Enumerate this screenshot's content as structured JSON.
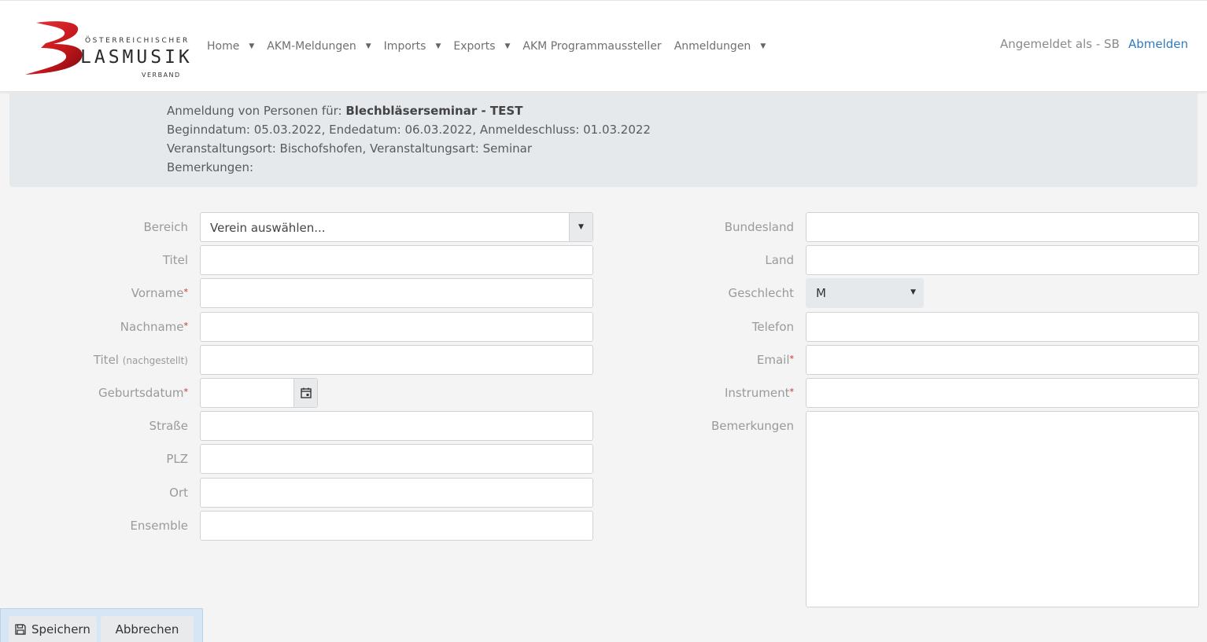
{
  "header": {
    "logo": {
      "top_text": "ÖSTERREICHISCHER",
      "main_text": "LASMUSIK",
      "bottom_text": "VERBAND",
      "brand_color": "#c4161c"
    },
    "nav": [
      {
        "label": "Home",
        "has_dropdown": true
      },
      {
        "label": "AKM-Meldungen",
        "has_dropdown": true
      },
      {
        "label": "Imports",
        "has_dropdown": true
      },
      {
        "label": "Exports",
        "has_dropdown": true
      },
      {
        "label": "AKM Programmaussteller",
        "has_dropdown": false
      },
      {
        "label": "Anmeldungen",
        "has_dropdown": true
      }
    ],
    "logged_in_text": "Angemeldet als - SB",
    "logout_label": "Abmelden"
  },
  "info": {
    "line1_prefix": "Anmeldung von Personen für: ",
    "line1_event": "Blechbläserseminar - TEST",
    "line2": "Beginndatum: 05.03.2022, Endedatum: 06.03.2022, Anmeldeschluss: 01.03.2022",
    "line3": "Veranstaltungsort: Bischofshofen, Veranstaltungsart: Seminar",
    "line4": "Bemerkungen:"
  },
  "form": {
    "bereich": {
      "label": "Bereich",
      "value": "Verein auswählen..."
    },
    "titel": {
      "label": "Titel",
      "value": ""
    },
    "vorname": {
      "label": "Vorname",
      "required": "*",
      "value": ""
    },
    "nachname": {
      "label": "Nachname",
      "required": "*",
      "value": ""
    },
    "titel_nach": {
      "label": "Titel",
      "label_small": "(nachgestellt)",
      "value": ""
    },
    "geburtsdatum": {
      "label": "Geburtsdatum",
      "required": "*",
      "value": ""
    },
    "strasse": {
      "label": "Straße",
      "value": ""
    },
    "plz": {
      "label": "PLZ",
      "value": ""
    },
    "ort": {
      "label": "Ort",
      "value": ""
    },
    "ensemble": {
      "label": "Ensemble",
      "value": ""
    },
    "bundesland": {
      "label": "Bundesland",
      "value": ""
    },
    "land": {
      "label": "Land",
      "value": ""
    },
    "geschlecht": {
      "label": "Geschlecht",
      "value": "M"
    },
    "telefon": {
      "label": "Telefon",
      "value": ""
    },
    "email": {
      "label": "Email",
      "required": "*",
      "value": ""
    },
    "instrument": {
      "label": "Instrument",
      "required": "*",
      "value": ""
    },
    "bemerkungen": {
      "label": "Bemerkungen",
      "value": ""
    }
  },
  "actions": {
    "save_label": "Speichern",
    "cancel_label": "Abbrechen"
  }
}
